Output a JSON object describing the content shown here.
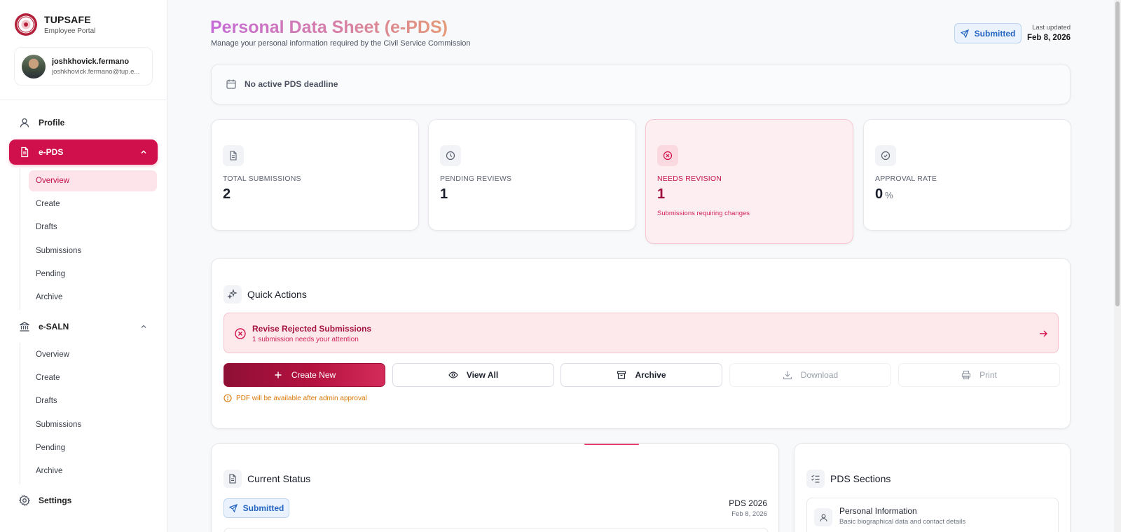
{
  "brand": {
    "title": "TUPSAFE",
    "subtitle": "Employee Portal"
  },
  "user": {
    "name": "joshkhovick.fermano",
    "email": "joshkhovick.fermano@tup.e..."
  },
  "sidebar": {
    "profile": "Profile",
    "epds": {
      "label": "e-PDS",
      "items": [
        "Overview",
        "Create",
        "Drafts",
        "Submissions",
        "Pending",
        "Archive"
      ]
    },
    "esaln": {
      "label": "e-SALN",
      "items": [
        "Overview",
        "Create",
        "Drafts",
        "Submissions",
        "Pending",
        "Archive"
      ]
    },
    "settings": "Settings"
  },
  "header": {
    "title": "Personal Data Sheet (e-PDS)",
    "subtitle": "Manage your personal information required by the Civil Service Commission",
    "status": "Submitted",
    "last_updated_label": "Last updated",
    "last_updated_date": "Feb 8, 2026"
  },
  "deadline": {
    "text": "No active PDS deadline"
  },
  "stats": [
    {
      "label": "TOTAL SUBMISSIONS",
      "value": "2"
    },
    {
      "label": "PENDING REVIEWS",
      "value": "1"
    },
    {
      "label": "NEEDS REVISION",
      "value": "1",
      "note": "Submissions requiring changes"
    },
    {
      "label": "APPROVAL RATE",
      "value": "0",
      "unit": "%"
    }
  ],
  "quick_actions": {
    "title": "Quick Actions",
    "alert_title": "Revise Rejected Submissions",
    "alert_sub": "1 submission needs your attention",
    "buttons": {
      "create": "Create New",
      "view": "View All",
      "archive": "Archive",
      "download": "Download",
      "print": "Print"
    },
    "note": "PDF will be available after admin approval"
  },
  "current_status": {
    "title": "Current Status",
    "status": "Submitted",
    "year": "PDS 2026",
    "date": "Feb 8, 2026"
  },
  "pds_sections": {
    "title": "PDS Sections",
    "items": [
      {
        "title": "Personal Information",
        "subtitle": "Basic biographical data and contact details"
      }
    ]
  },
  "colors": {
    "accent": "#d0104c",
    "status_blue": "#2566c2",
    "warning": "#d97706"
  }
}
